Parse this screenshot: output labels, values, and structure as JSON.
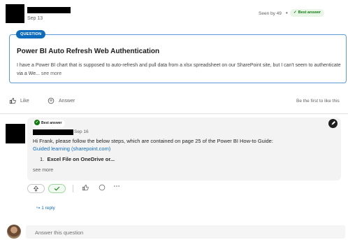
{
  "post": {
    "date": "Sep 13",
    "seen_by": "Seen by 49",
    "seen_sep": "•",
    "best_answer_badge": "Best answer",
    "check_glyph": "✓"
  },
  "question": {
    "label": "QUESTION",
    "title": "Power BI Auto Refresh Web Authentication",
    "body": "I have a Power BI chart that is supposed to auto-refresh and pull data from a xlsx spreadsheet on our SharePoint site, but I can't seem to authenticate via a We...",
    "see_more": "see more"
  },
  "actions": {
    "like": "Like",
    "answer": "Answer",
    "first_to_like": "Be the first to like this"
  },
  "answer": {
    "best_answer_badge": "Best answer",
    "date": "Sep 16",
    "text": "Hi Frank, please follow the below steps, which are contained on page 25 of the Power BI How-to Guide:",
    "link": "Guided learning (sharepoint.com)",
    "list_number": "1.",
    "list_item": "Excel File on OneDrive or...",
    "see_more": "see more",
    "reply": "1 reply"
  },
  "compose": {
    "placeholder": "Answer this question"
  },
  "icons": {
    "like": "thumb-up-icon",
    "answer": "chat-bubble-icon",
    "upvote": "arrow-up-icon",
    "downvote": "arrow-down-icon",
    "accepted": "check-icon",
    "more": "ellipsis-icon"
  },
  "colors": {
    "accent": "#0f6cbd",
    "success": "#107c10",
    "card_border": "#5b9bd5"
  }
}
